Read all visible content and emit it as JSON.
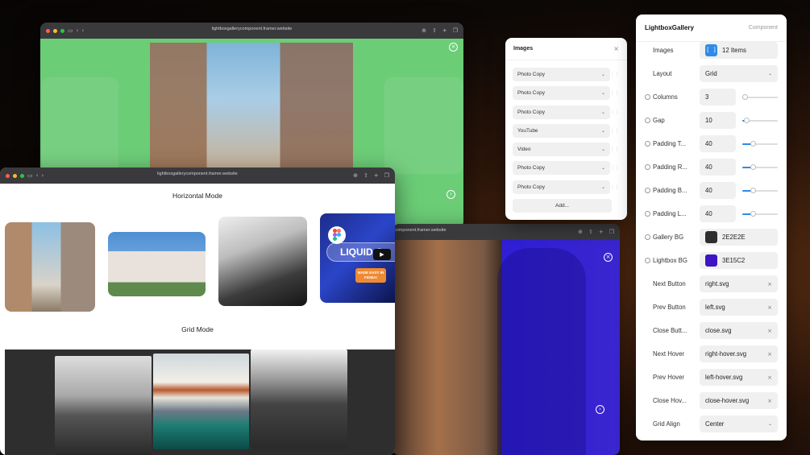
{
  "window_top": {
    "url": "lightboxgallerycomponent.framer.website"
  },
  "window_left": {
    "url": "lightboxgallerycomponent.framer.website",
    "horizontal_title": "Horizontal Mode",
    "grid_title": "Grid Mode",
    "liquid_text": "LIQUID G",
    "badge_text": "MADE EASY IN FIGMA!"
  },
  "window_right": {
    "url": "component.framer.website"
  },
  "images_panel": {
    "title": "Images",
    "items": [
      "Photo Copy",
      "Photo Copy",
      "Photo Copy",
      "YouTube",
      "Video",
      "Photo Copy",
      "Photo Copy"
    ],
    "add_label": "Add..."
  },
  "props": {
    "title": "LightboxGallery",
    "subtitle": "Component",
    "images": {
      "label": "Images",
      "value": "12 Items"
    },
    "layout": {
      "label": "Layout",
      "value": "Grid"
    },
    "columns": {
      "label": "Columns",
      "value": "3"
    },
    "gap": {
      "label": "Gap",
      "value": "10"
    },
    "padding_top": {
      "label": "Padding T...",
      "value": "40"
    },
    "padding_right": {
      "label": "Padding R...",
      "value": "40"
    },
    "padding_bottom": {
      "label": "Padding B...",
      "value": "40"
    },
    "padding_left": {
      "label": "Padding L...",
      "value": "40"
    },
    "gallery_bg": {
      "label": "Gallery BG",
      "value": "2E2E2E",
      "color": "#2E2E2E"
    },
    "lightbox_bg": {
      "label": "Lightbox BG",
      "value": "3E15C2",
      "color": "#3E15C2"
    },
    "next_button": {
      "label": "Next Button",
      "value": "right.svg"
    },
    "prev_button": {
      "label": "Prev Button",
      "value": "left.svg"
    },
    "close_button": {
      "label": "Close Butt...",
      "value": "close.svg"
    },
    "next_hover": {
      "label": "Next Hover",
      "value": "right-hover.svg"
    },
    "prev_hover": {
      "label": "Prev Hover",
      "value": "left-hover.svg"
    },
    "close_hover": {
      "label": "Close Hov...",
      "value": "close-hover.svg"
    },
    "grid_align": {
      "label": "Grid Align",
      "value": "Center"
    }
  },
  "colors": {
    "green_bg": "#6CCD77",
    "accent": "#2F8AE8"
  }
}
